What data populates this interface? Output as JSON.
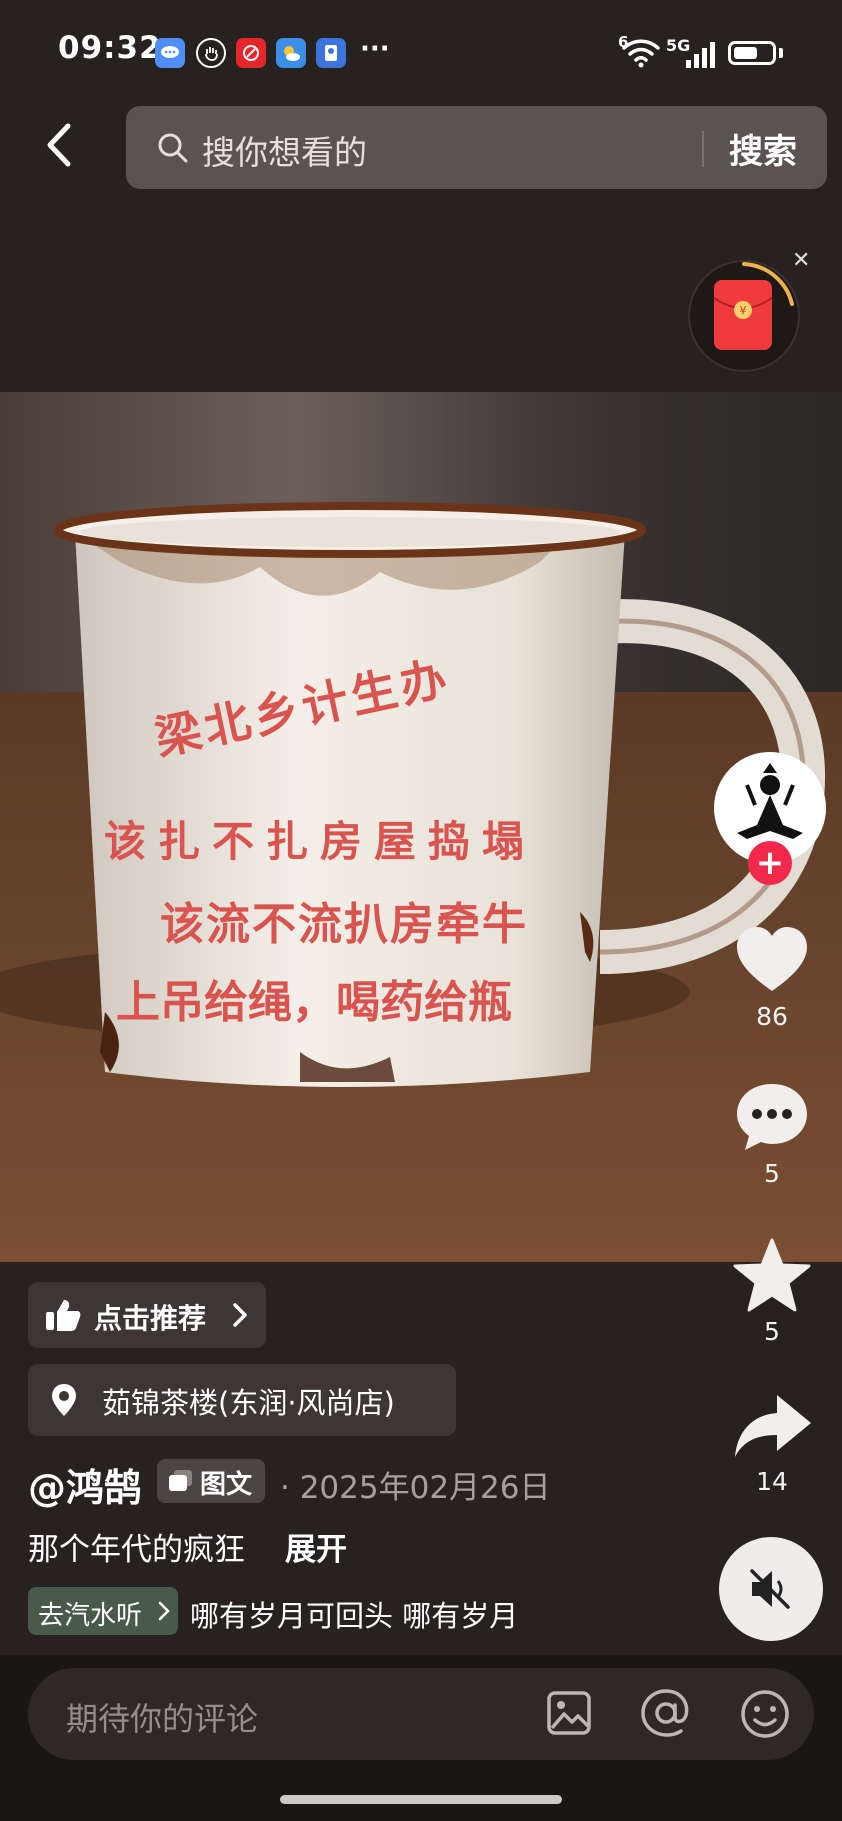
{
  "status_bar": {
    "time": "09:32",
    "more": "···",
    "network": "5G",
    "wifi_label": "6",
    "app_icons": [
      "message-icon",
      "hand-icon",
      "red-app-icon",
      "weather-icon",
      "blue-app-icon"
    ]
  },
  "header": {
    "search_placeholder": "搜你想看的",
    "search_button": "搜索"
  },
  "image_text": {
    "arc": "梁北乡计生办",
    "line1": "该扎不扎房屋捣塌",
    "line2": "该流不流扒房牵牛",
    "line3": "上吊给绳，喝药给瓶"
  },
  "rail": {
    "likes": "86",
    "comments": "5",
    "favorites": "5",
    "shares": "14",
    "follow_symbol": "+"
  },
  "info": {
    "recommend_label": "点击推荐",
    "location": "茹锦茶楼(东润·风尚店)",
    "author": "@鸿鹄",
    "type_tag": "图文",
    "date": "· 2025年02月26日",
    "description": "那个年代的疯狂",
    "expand": "展开",
    "music_chip": "去汽水听",
    "music_text": "哪有岁月可回头    哪有岁月"
  },
  "comment": {
    "placeholder": "期待你的评论"
  },
  "colors": {
    "background": "#272120",
    "accent_red": "#f2284a",
    "mug_text": "#d9544f"
  }
}
